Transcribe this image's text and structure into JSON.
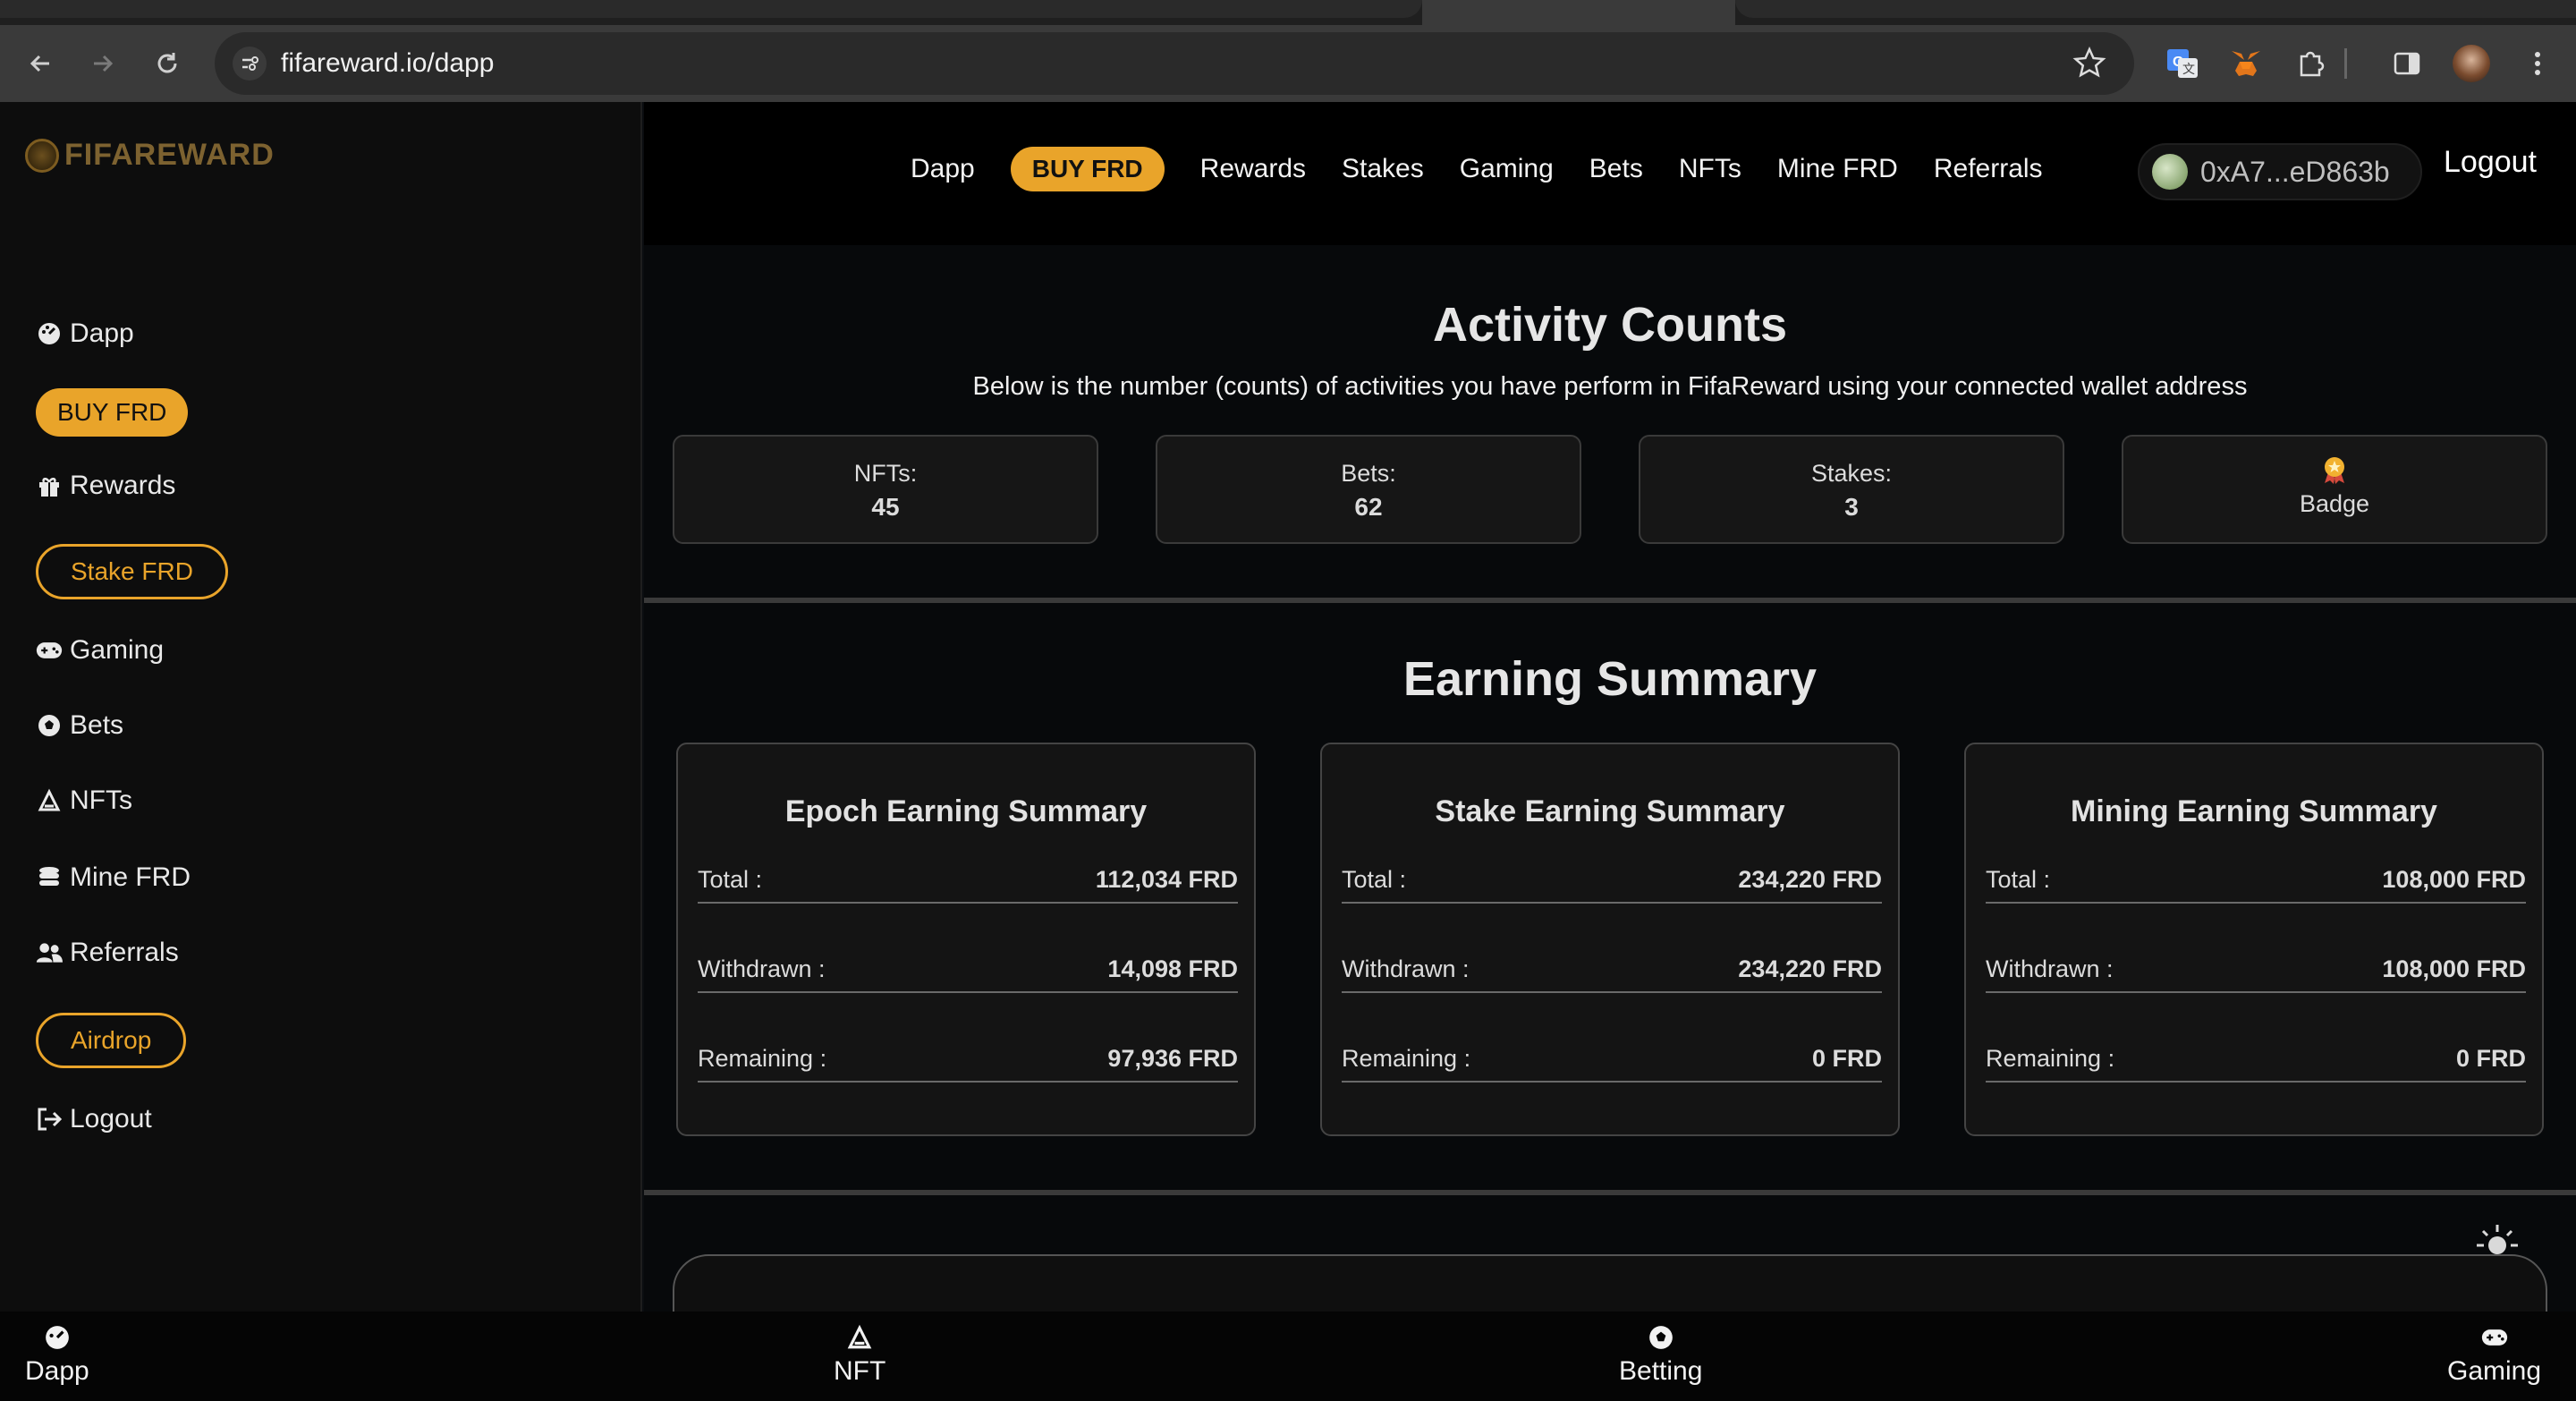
{
  "browser": {
    "url": "fifareward.io/dapp"
  },
  "sidebar": {
    "logo_text": "FIFAREWARD",
    "items": [
      {
        "label": "Dapp"
      },
      {
        "label": "BUY FRD"
      },
      {
        "label": "Rewards"
      },
      {
        "label": "Stake FRD"
      },
      {
        "label": "Gaming"
      },
      {
        "label": "Bets"
      },
      {
        "label": "NFTs"
      },
      {
        "label": "Mine FRD"
      },
      {
        "label": "Referrals"
      },
      {
        "label": "Airdrop"
      },
      {
        "label": "Logout"
      }
    ]
  },
  "topnav": {
    "links": [
      "Dapp",
      "BUY FRD",
      "Rewards",
      "Stakes",
      "Gaming",
      "Bets",
      "NFTs",
      "Mine FRD",
      "Referrals"
    ],
    "wallet_address": "0xA7...eD863b",
    "logout_label": "Logout"
  },
  "activity": {
    "title": "Activity Counts",
    "subtitle": "Below is the number (counts) of activities you have perform in FifaReward using your connected wallet address",
    "cards": [
      {
        "label": "NFTs:",
        "value": "45"
      },
      {
        "label": "Bets:",
        "value": "62"
      },
      {
        "label": "Stakes:",
        "value": "3"
      },
      {
        "label": "Badge",
        "value": ""
      }
    ]
  },
  "earning": {
    "title": "Earning Summary",
    "cards": [
      {
        "title": "Epoch Earning Summary",
        "rows": [
          {
            "k": "Total :",
            "v": "112,034 FRD"
          },
          {
            "k": "Withdrawn :",
            "v": "14,098 FRD"
          },
          {
            "k": "Remaining :",
            "v": "97,936 FRD"
          }
        ]
      },
      {
        "title": "Stake Earning Summary",
        "rows": [
          {
            "k": "Total :",
            "v": "234,220 FRD"
          },
          {
            "k": "Withdrawn :",
            "v": "234,220 FRD"
          },
          {
            "k": "Remaining :",
            "v": "0 FRD"
          }
        ]
      },
      {
        "title": "Mining Earning Summary",
        "rows": [
          {
            "k": "Total :",
            "v": "108,000 FRD"
          },
          {
            "k": "Withdrawn :",
            "v": "108,000 FRD"
          },
          {
            "k": "Remaining :",
            "v": "0 FRD"
          }
        ]
      }
    ]
  },
  "bottomnav": {
    "items": [
      "Dapp",
      "NFT",
      "Betting",
      "Gaming"
    ]
  },
  "colors": {
    "accent": "#e9a42a",
    "background": "#07090b"
  }
}
